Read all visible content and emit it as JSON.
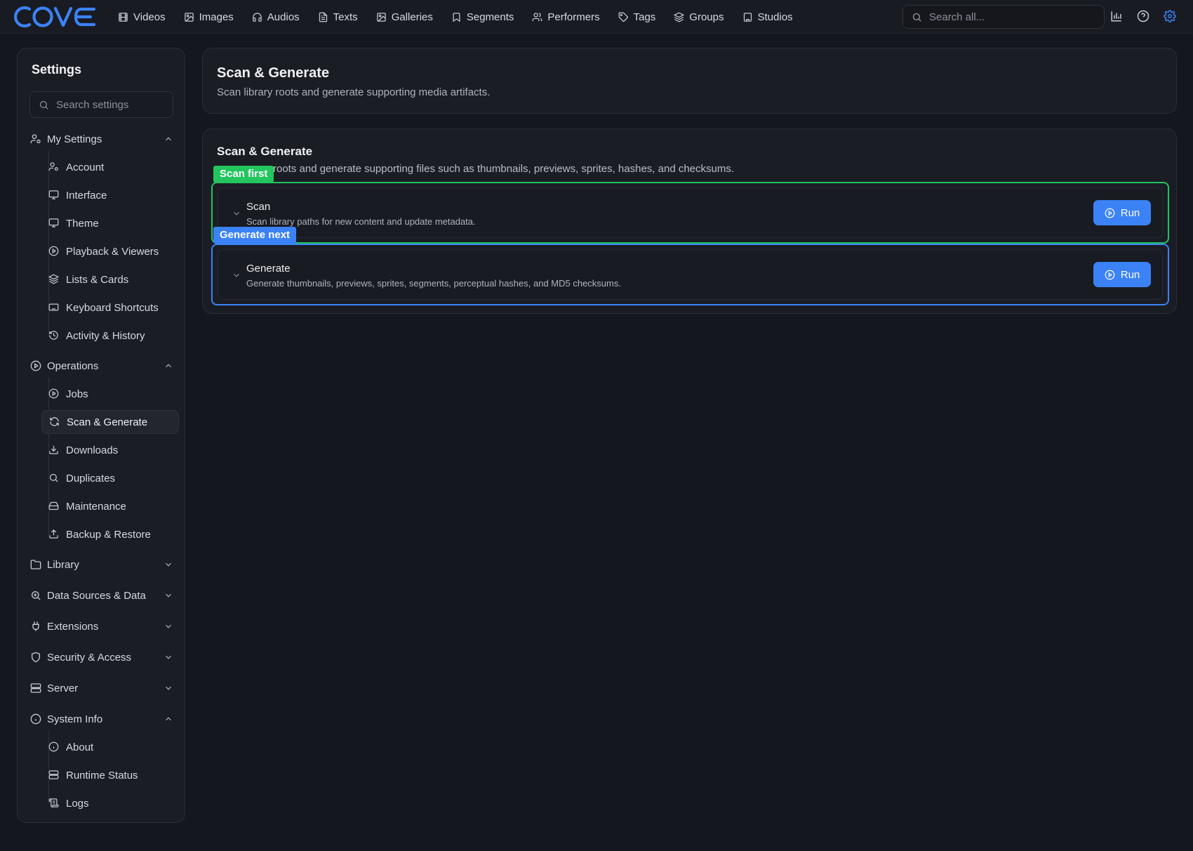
{
  "brand": {
    "logo_text": "COVE",
    "accent": "#3b82f6"
  },
  "nav": {
    "items": [
      {
        "label": "Videos",
        "icon": "film-icon"
      },
      {
        "label": "Images",
        "icon": "image-icon"
      },
      {
        "label": "Audios",
        "icon": "headphones-icon"
      },
      {
        "label": "Texts",
        "icon": "document-icon"
      },
      {
        "label": "Galleries",
        "icon": "gallery-icon"
      },
      {
        "label": "Segments",
        "icon": "bookmark-icon"
      },
      {
        "label": "Performers",
        "icon": "users-icon"
      },
      {
        "label": "Tags",
        "icon": "tag-icon"
      },
      {
        "label": "Groups",
        "icon": "layers-icon"
      },
      {
        "label": "Studios",
        "icon": "building-icon"
      }
    ],
    "search_placeholder": "Search all...",
    "right_icons": [
      "stats-icon",
      "help-icon",
      "settings-gear-icon"
    ]
  },
  "sidebar": {
    "title": "Settings",
    "search_placeholder": "Search settings",
    "groups": [
      {
        "label": "My Settings",
        "icon": "user-cog-icon",
        "expanded": true,
        "items": [
          {
            "label": "Account",
            "icon": "user-cog-icon"
          },
          {
            "label": "Interface",
            "icon": "monitor-icon"
          },
          {
            "label": "Theme",
            "icon": "monitor-icon"
          },
          {
            "label": "Playback & Viewers",
            "icon": "play-circle-icon"
          },
          {
            "label": "Lists & Cards",
            "icon": "layers-icon"
          },
          {
            "label": "Keyboard Shortcuts",
            "icon": "keyboard-icon"
          },
          {
            "label": "Activity & History",
            "icon": "history-icon"
          }
        ]
      },
      {
        "label": "Operations",
        "icon": "play-circle-icon",
        "expanded": true,
        "items": [
          {
            "label": "Jobs",
            "icon": "play-circle-icon"
          },
          {
            "label": "Scan & Generate",
            "icon": "refresh-icon",
            "active": true
          },
          {
            "label": "Downloads",
            "icon": "download-icon"
          },
          {
            "label": "Duplicates",
            "icon": "search-icon"
          },
          {
            "label": "Maintenance",
            "icon": "hard-drive-icon"
          },
          {
            "label": "Backup & Restore",
            "icon": "upload-icon"
          }
        ]
      },
      {
        "label": "Library",
        "icon": "folder-icon",
        "expanded": false,
        "items": []
      },
      {
        "label": "Data Sources & Data",
        "icon": "search-data-icon",
        "expanded": false,
        "items": []
      },
      {
        "label": "Extensions",
        "icon": "plug-icon",
        "expanded": false,
        "items": []
      },
      {
        "label": "Security & Access",
        "icon": "shield-icon",
        "expanded": false,
        "items": []
      },
      {
        "label": "Server",
        "icon": "server-icon",
        "expanded": false,
        "items": []
      },
      {
        "label": "System Info",
        "icon": "info-icon",
        "expanded": true,
        "items": [
          {
            "label": "About",
            "icon": "info-icon"
          },
          {
            "label": "Runtime Status",
            "icon": "server-icon"
          },
          {
            "label": "Logs",
            "icon": "scroll-icon"
          }
        ]
      }
    ]
  },
  "header": {
    "title": "Scan & Generate",
    "subtitle": "Scan library roots and generate supporting media artifacts."
  },
  "main": {
    "title": "Scan & Generate",
    "description_visible": "roots and generate supporting files such as thumbnails, previews, sprites, hashes, and checksums.",
    "tasks": [
      {
        "tag": "Scan first",
        "tag_color": "#22c55e",
        "name": "Scan",
        "description": "Scan library paths for new content and update metadata.",
        "button": "Run"
      },
      {
        "tag": "Generate next",
        "tag_color": "#3b82f6",
        "name": "Generate",
        "description": "Generate thumbnails, previews, sprites, segments, perceptual hashes, and MD5 checksums.",
        "button": "Run"
      }
    ]
  }
}
